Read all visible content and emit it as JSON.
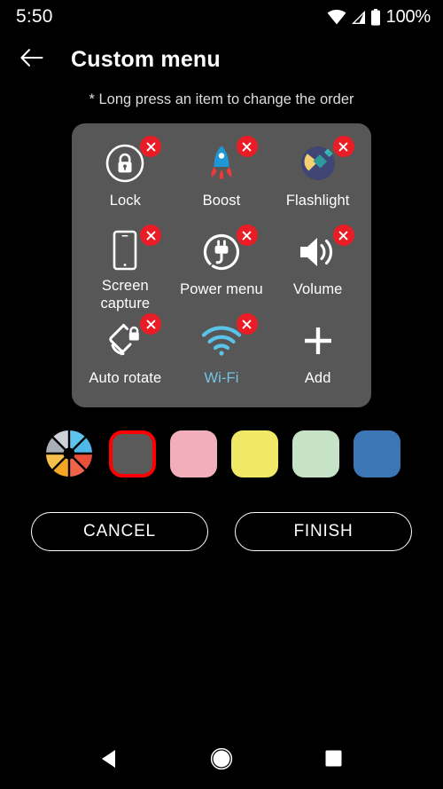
{
  "status_bar": {
    "time": "5:50",
    "battery_percent": "100%",
    "icons": [
      "wifi-icon",
      "cellular-signal-icon",
      "battery-icon"
    ]
  },
  "app_bar": {
    "back_icon": "back-arrow-icon",
    "title": "Custom menu"
  },
  "hint": "* Long press an item to change the order",
  "menu_panel": {
    "background_color": "#575757",
    "remove_badge_color": "#ea1d26",
    "items": [
      {
        "label": "Lock",
        "icon": "lock-icon",
        "removable": true,
        "enabled": false
      },
      {
        "label": "Boost",
        "icon": "rocket-icon",
        "removable": true,
        "enabled": false
      },
      {
        "label": "Flashlight",
        "icon": "flashlight-icon",
        "removable": true,
        "enabled": false
      },
      {
        "label": "Screen\ncapture",
        "icon": "screenshot-icon",
        "removable": true,
        "enabled": false
      },
      {
        "label": "Power\nmenu",
        "icon": "power-plug-icon",
        "removable": true,
        "enabled": false
      },
      {
        "label": "Volume",
        "icon": "volume-icon",
        "removable": true,
        "enabled": false
      },
      {
        "label": "Auto rotate",
        "icon": "auto-rotate-lock-icon",
        "removable": true,
        "enabled": false
      },
      {
        "label": "Wi-Fi",
        "icon": "wifi-signal-icon",
        "removable": true,
        "enabled": true
      },
      {
        "label": "Add",
        "icon": "plus-icon",
        "removable": false,
        "enabled": false
      }
    ],
    "active_label_color": "#73c4e6"
  },
  "color_picker": {
    "wheel_icon": "color-wheel-icon",
    "wheel_colors": [
      "#5ec4ef",
      "#4fb8e8",
      "#e8503a",
      "#f06449",
      "#f5a623",
      "#f8c04a",
      "#a9afb8",
      "#ced3da"
    ],
    "selected_index": 0,
    "selection_outline": "#ff0000",
    "swatches": [
      {
        "name": "gray",
        "color": "#5a5a5a"
      },
      {
        "name": "pink",
        "color": "#f2aebb"
      },
      {
        "name": "yellow",
        "color": "#f2e868"
      },
      {
        "name": "light-green",
        "color": "#c6e3c8"
      },
      {
        "name": "blue",
        "color": "#3d76b4"
      }
    ]
  },
  "actions": {
    "cancel_label": "CANCEL",
    "finish_label": "FINISH"
  },
  "nav_bar": {
    "back": "nav-back-icon",
    "home": "nav-home-icon",
    "recents": "nav-recents-icon"
  }
}
